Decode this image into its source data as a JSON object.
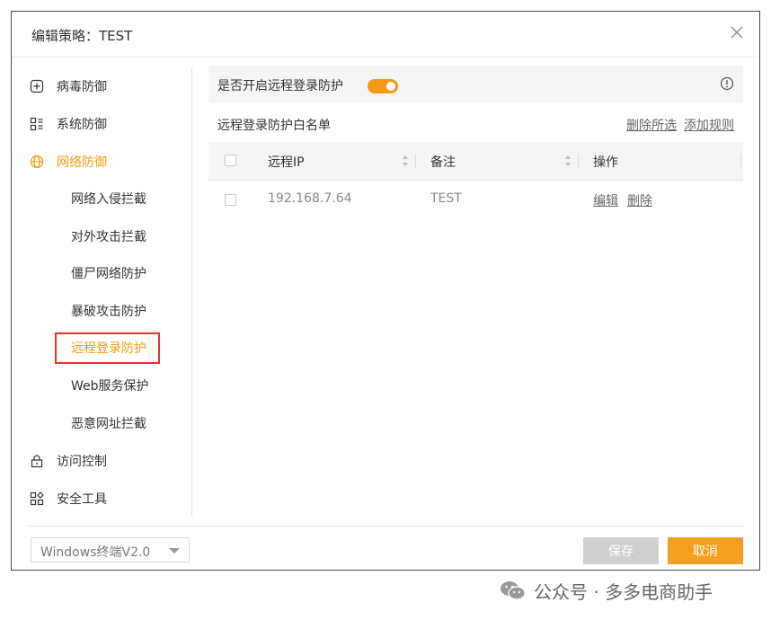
{
  "dialog": {
    "title": "编辑策略：TEST",
    "close_icon": "close-icon"
  },
  "sidebar": {
    "items": [
      {
        "label": "病毒防御",
        "icon": "plus-square-icon",
        "active": false
      },
      {
        "label": "系统防御",
        "icon": "grid-icon",
        "active": false
      },
      {
        "label": "网络防御",
        "icon": "globe-icon",
        "active": true
      },
      {
        "label": "访问控制",
        "icon": "lock-icon",
        "active": false
      },
      {
        "label": "安全工具",
        "icon": "apps-icon",
        "active": false
      }
    ],
    "subitems": [
      {
        "label": "网络入侵拦截",
        "active": false
      },
      {
        "label": "对外攻击拦截",
        "active": false
      },
      {
        "label": "僵尸网络防护",
        "active": false
      },
      {
        "label": "暴破攻击防护",
        "active": false
      },
      {
        "label": "远程登录防护",
        "active": true
      },
      {
        "label": "Web服务保护",
        "active": false
      },
      {
        "label": "恶意网址拦截",
        "active": false
      }
    ]
  },
  "main": {
    "toggle": {
      "label": "是否开启远程登录防护",
      "on": true
    },
    "whitelist_title": "远程登录防护白名单",
    "actions": {
      "delete_selected": "删除所选",
      "add_rule": "添加规则"
    },
    "table": {
      "headers": [
        "远程IP",
        "备注",
        "操作"
      ],
      "rows": [
        {
          "ip": "192.168.7.64",
          "note": "TEST",
          "edit": "编辑",
          "delete": "删除"
        }
      ]
    }
  },
  "footer": {
    "version_select": "Windows终端V2.0",
    "save_label": "保存",
    "cancel_label": "取消"
  },
  "watermark": "公众号 · 多多电商助手",
  "colors": {
    "accent": "#f39a12",
    "highlight_border": "#e0342e",
    "disabled": "#cfcfcf"
  }
}
